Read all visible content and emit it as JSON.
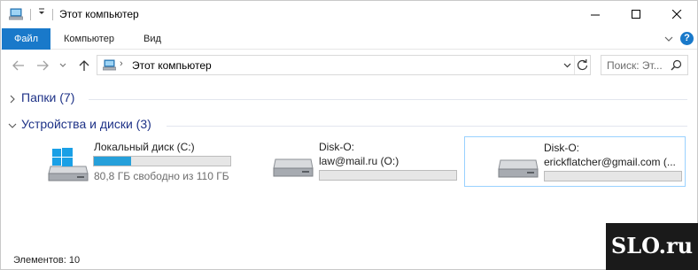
{
  "window": {
    "title": "Этот компьютер"
  },
  "ribbon": {
    "tabs": [
      "Файл",
      "Компьютер",
      "Вид"
    ],
    "help_label": "?"
  },
  "address_bar": {
    "separator": "›",
    "path": "Этот компьютер",
    "search_placeholder": "Поиск: Эт..."
  },
  "groups": {
    "folders": "Папки (7)",
    "devices": "Устройства и диски (3)"
  },
  "drives": [
    {
      "name": "Локальный диск (C:)",
      "free_text": "80,8 ГБ свободно из 110 ГБ",
      "used_fraction": 0.27,
      "icon": "windows-drive-icon"
    },
    {
      "name": "Disk-O:",
      "sub": "law@mail.ru (O:)",
      "used_fraction": 0,
      "icon": "network-drive-icon"
    },
    {
      "name": "Disk-O:",
      "sub": "erickflatcher@gmail.com (...",
      "used_fraction": 0,
      "icon": "network-drive-icon",
      "selected": true
    }
  ],
  "status": {
    "items_text": "Элементов: 10"
  },
  "watermark": {
    "text": "SLO.ru"
  },
  "colors": {
    "accent": "#1979ca",
    "group_title": "#1e3287",
    "bar_fill": "#26a0da",
    "selection_border": "#99d1ff"
  }
}
